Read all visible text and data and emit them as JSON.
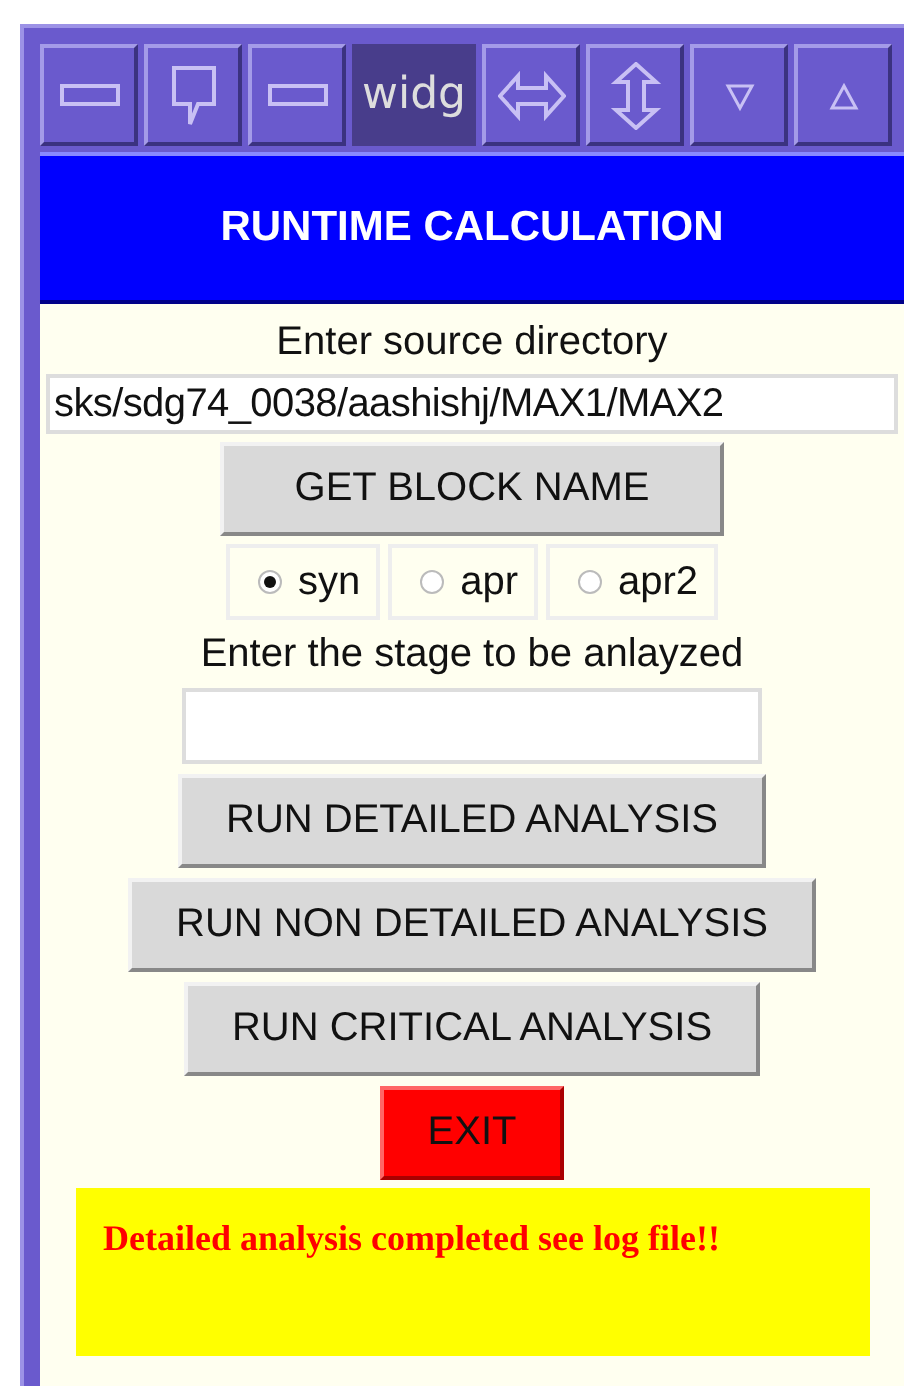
{
  "title_bar": {
    "label": "widg"
  },
  "header": {
    "title": "RUNTIME CALCULATION"
  },
  "source": {
    "label": "Enter source directory",
    "value": "sks/sdg74_0038/aashishj/MAX1/MAX2"
  },
  "get_block_button": "GET BLOCK NAME",
  "radios": [
    {
      "label": "syn",
      "selected": true
    },
    {
      "label": "apr",
      "selected": false
    },
    {
      "label": "apr2",
      "selected": false
    }
  ],
  "stage": {
    "label": "Enter the stage to be anlayzed"
  },
  "actions": [
    {
      "label": "RUN DETAILED ANALYSIS",
      "kind": "normal"
    },
    {
      "label": "RUN NON DETAILED ANALYSIS",
      "kind": "normal"
    },
    {
      "label": "RUN CRITICAL ANALYSIS",
      "kind": "normal"
    },
    {
      "label": "EXIT",
      "kind": "danger"
    }
  ],
  "status": "Detailed analysis completed see log file!!"
}
